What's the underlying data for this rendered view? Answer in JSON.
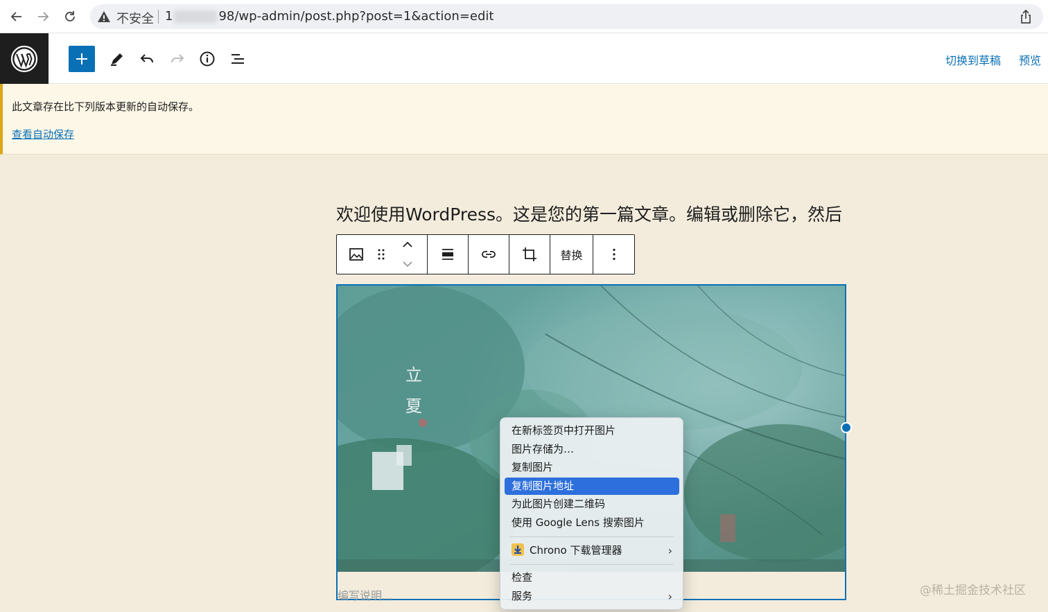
{
  "browser": {
    "insecure_label": "不安全",
    "url_prefix": "1",
    "url_suffix": "98/wp-admin/post.php?post=1&action=edit"
  },
  "header": {
    "switch_to_draft": "切换到草稿",
    "preview": "预览"
  },
  "notice": {
    "message": "此文章存在比下列版本更新的自动保存。",
    "link": "查看自动保存"
  },
  "editor": {
    "paragraph": "欢迎使用WordPress。这是您的第一篇文章。编辑或删除它，然后",
    "toolbar": {
      "replace_label": "替换"
    },
    "image": {
      "overlay_text": [
        "立",
        "夏"
      ]
    },
    "caption_placeholder": "编写说明…"
  },
  "context_menu": {
    "items": [
      {
        "label": "在新标签页中打开图片"
      },
      {
        "label": "图片存储为…"
      },
      {
        "label": "复制图片"
      },
      {
        "label": "复制图片地址",
        "active": true
      },
      {
        "label": "为此图片创建二维码"
      },
      {
        "label": "使用 Google Lens 搜索图片"
      },
      {
        "label": "Chrono 下载管理器",
        "submenu": true
      },
      {
        "label": "检查"
      },
      {
        "label": "服务",
        "submenu": true
      }
    ],
    "submenu_arrow": "›"
  },
  "watermark": "@稀土掘金技术社区",
  "colors": {
    "wp_blue": "#0a70b6",
    "highlight": "#2d6fdc",
    "canvas_bg": "#f3ecdc",
    "notice_border": "#dba617"
  }
}
